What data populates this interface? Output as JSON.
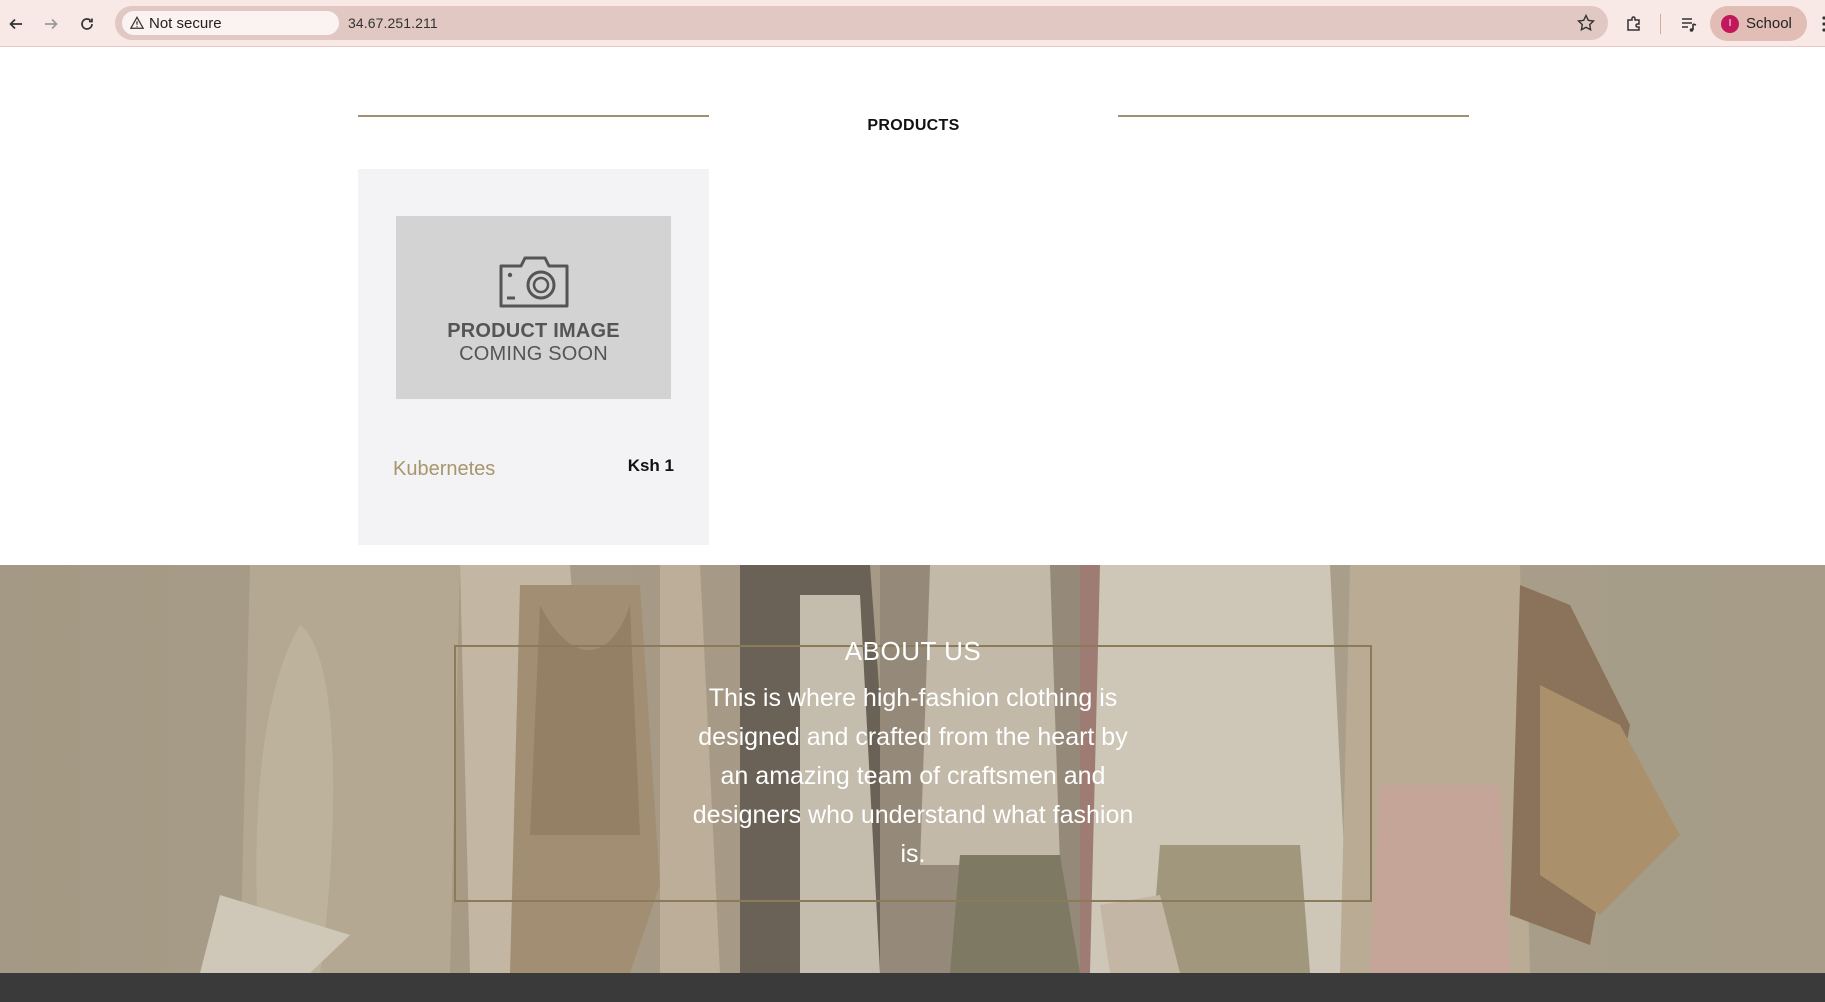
{
  "browser": {
    "security_label": "Not secure",
    "url": "34.67.251.211",
    "profile_name": "School",
    "profile_initial": "I"
  },
  "products": {
    "title": "PRODUCTS",
    "items": [
      {
        "image_line1": "PRODUCT IMAGE",
        "image_line2": "COMING SOON",
        "name": "Kubernetes",
        "price": "Ksh 1"
      }
    ]
  },
  "about": {
    "title": "ABOUT US",
    "text": "This is where high-fashion clothing is designed and crafted from the heart by an amazing team of craftsmen and designers who understand what fashion is."
  },
  "colors": {
    "accent": "#a8956c",
    "rule": "#a08f70",
    "chrome_bg": "#f9e9e6",
    "footer": "#3a3a3a"
  }
}
